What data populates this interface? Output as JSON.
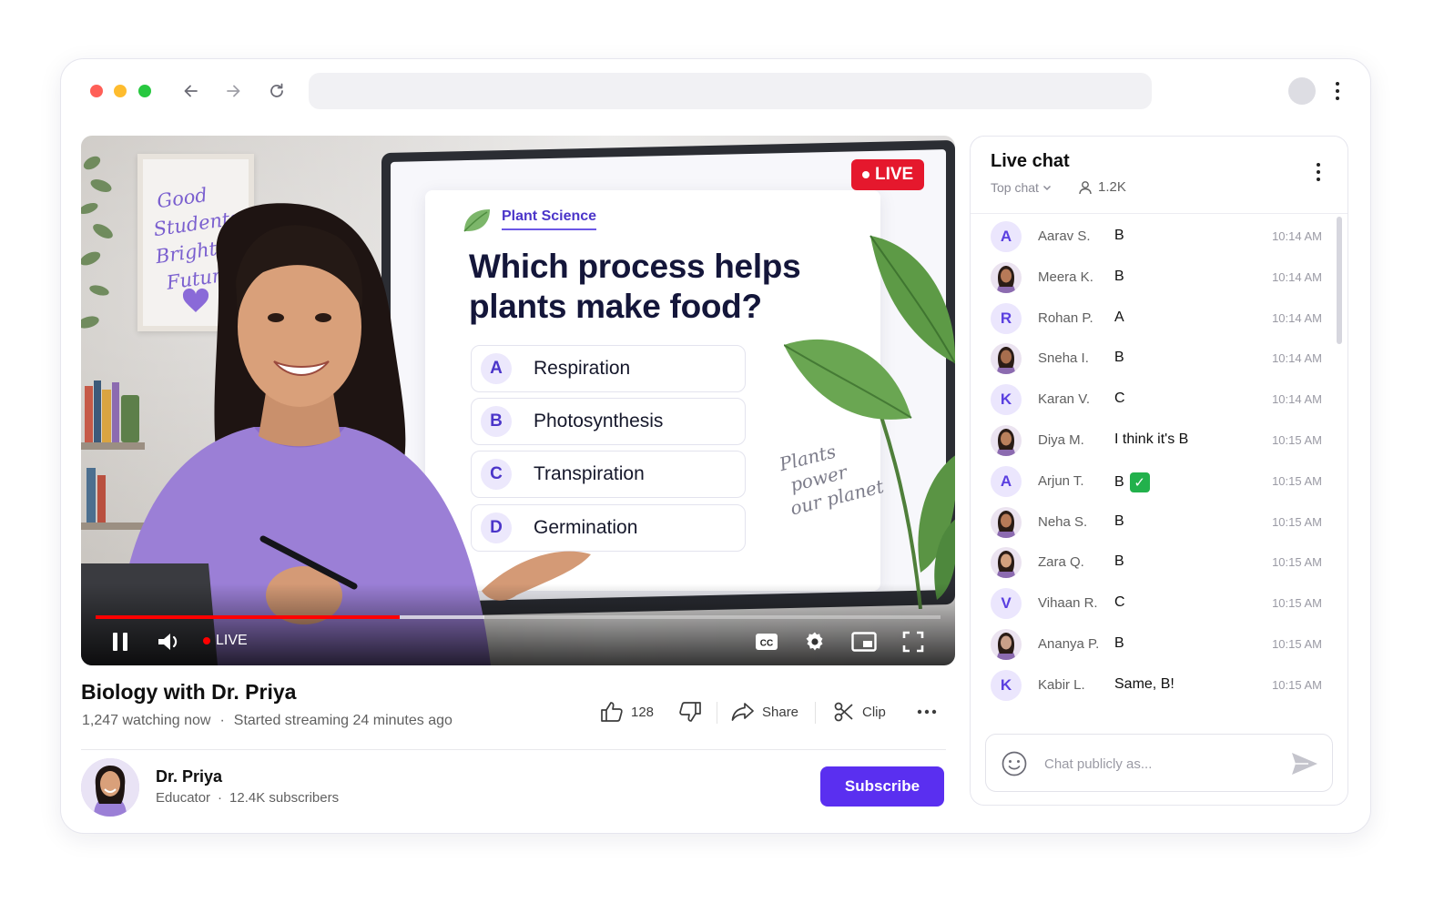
{
  "browser": {
    "url_value": ""
  },
  "player": {
    "live_badge": "LIVE",
    "control_live_label": "LIVE",
    "progress_played_fraction": 0.36,
    "progress_buffered_fraction": 0.46,
    "poster_lines": [
      "Good",
      "Students",
      "Brighter",
      "Futures"
    ],
    "slide": {
      "topic": "Plant Science",
      "question": "Which process helps plants make food?",
      "options": [
        {
          "letter": "A",
          "text": "Respiration"
        },
        {
          "letter": "B",
          "text": "Photosynthesis"
        },
        {
          "letter": "C",
          "text": "Transpiration"
        },
        {
          "letter": "D",
          "text": "Germination"
        }
      ],
      "handwritten_note": [
        "Plants",
        "power",
        "our planet"
      ]
    }
  },
  "video": {
    "title": "Biology with Dr. Priya",
    "watching": "1,247 watching now",
    "separator": "·",
    "started": "Started streaming 24 minutes ago",
    "actions": {
      "like_count": "128",
      "share_label": "Share",
      "clip_label": "Clip"
    }
  },
  "channel": {
    "name": "Dr. Priya",
    "role": "Educator",
    "separator": "·",
    "subscribers": "12.4K subscribers",
    "subscribe_label": "Subscribe"
  },
  "chat": {
    "title": "Live chat",
    "mode": "Top chat",
    "viewers": "1.2K",
    "input_placeholder": "Chat publicly as...",
    "messages": [
      {
        "avatar": "A",
        "name": "Aarav S.",
        "text": "B",
        "time": "10:14 AM"
      },
      {
        "avatar": "photo",
        "name": "Meera K.",
        "text": "B",
        "time": "10:14 AM"
      },
      {
        "avatar": "R",
        "name": "Rohan P.",
        "text": "A",
        "time": "10:14 AM"
      },
      {
        "avatar": "photo",
        "name": "Sneha I.",
        "text": "B",
        "time": "10:14 AM"
      },
      {
        "avatar": "K",
        "name": "Karan V.",
        "text": "C",
        "time": "10:14 AM"
      },
      {
        "avatar": "photo",
        "name": "Diya M.",
        "text": "I think it's B",
        "time": "10:15 AM"
      },
      {
        "avatar": "A",
        "name": "Arjun T.",
        "text": "B",
        "emoji": "check-mark-button",
        "time": "10:15 AM"
      },
      {
        "avatar": "photo",
        "name": "Neha S.",
        "text": "B",
        "time": "10:15 AM"
      },
      {
        "avatar": "photo",
        "name": "Zara Q.",
        "text": "B",
        "time": "10:15 AM"
      },
      {
        "avatar": "V",
        "name": "Vihaan R.",
        "text": "C",
        "time": "10:15 AM"
      },
      {
        "avatar": "photo",
        "name": "Ananya P.",
        "text": "B",
        "time": "10:15 AM"
      },
      {
        "avatar": "K",
        "name": "Kabir L.",
        "text": "Same, B!",
        "time": "10:15 AM"
      }
    ]
  },
  "colors": {
    "accent": "#5a2ff0",
    "live_red": "#e5182d",
    "avatar_letter_bg": "#ebe6fd",
    "avatar_letter_fg": "#5a3fe0"
  }
}
